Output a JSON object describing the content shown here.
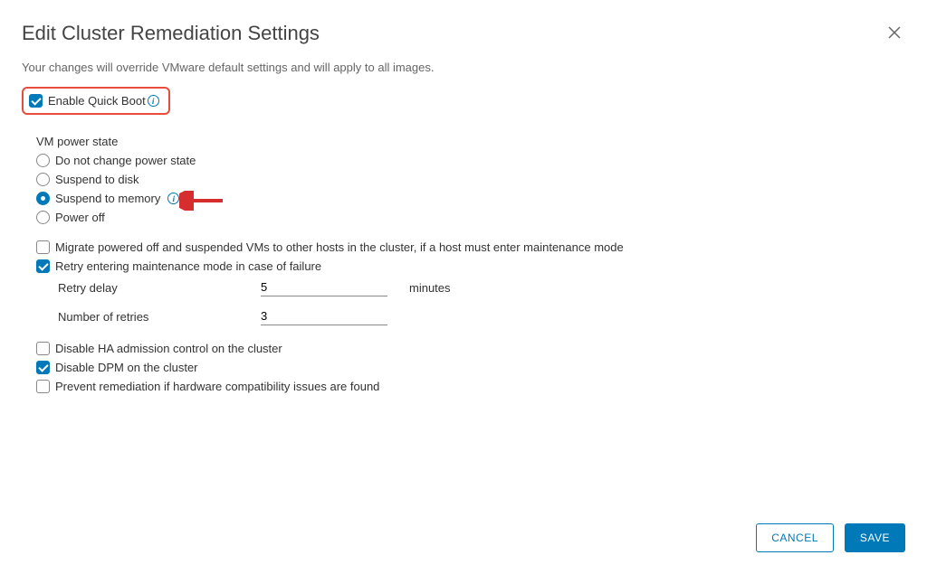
{
  "dialog": {
    "title": "Edit Cluster Remediation Settings",
    "subtitle": "Your changes will override VMware default settings and will apply to all images."
  },
  "quickBoot": {
    "label": "Enable Quick Boot",
    "checked": true
  },
  "vmPowerState": {
    "label": "VM power state",
    "options": [
      {
        "label": "Do not change power state",
        "selected": false
      },
      {
        "label": "Suspend to disk",
        "selected": false
      },
      {
        "label": "Suspend to memory",
        "selected": true,
        "hasInfo": true
      },
      {
        "label": "Power off",
        "selected": false
      }
    ]
  },
  "maintenance": {
    "migrate": {
      "label": "Migrate powered off and suspended VMs to other hosts in the cluster, if a host must enter maintenance mode",
      "checked": false
    },
    "retry": {
      "label": "Retry entering maintenance mode in case of failure",
      "checked": true,
      "retryDelay": {
        "label": "Retry delay",
        "value": "5",
        "unit": "minutes"
      },
      "numRetries": {
        "label": "Number of retries",
        "value": "3"
      }
    }
  },
  "clusterOptions": {
    "disableHA": {
      "label": "Disable HA admission control on the cluster",
      "checked": false
    },
    "disableDPM": {
      "label": "Disable DPM on the cluster",
      "checked": true
    },
    "preventRemediation": {
      "label": "Prevent remediation if hardware compatibility issues are found",
      "checked": false
    }
  },
  "footer": {
    "cancel": "CANCEL",
    "save": "SAVE"
  }
}
